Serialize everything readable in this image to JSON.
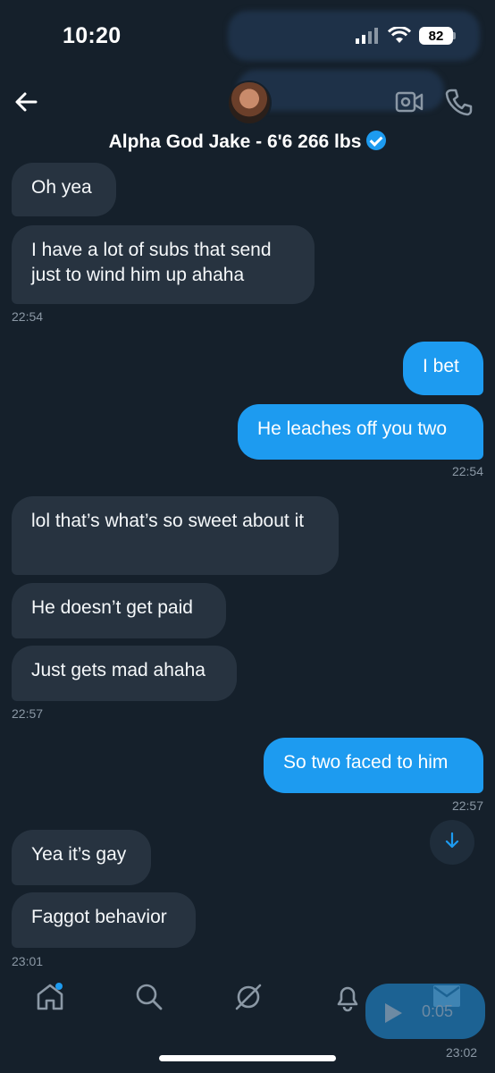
{
  "status_bar": {
    "time": "10:20",
    "battery": "82"
  },
  "header": {
    "contact_name": "Alpha God Jake - 6'6 266 lbs"
  },
  "messages": [
    {
      "side": "in",
      "text": "Oh yea"
    },
    {
      "side": "in",
      "text": "I have a lot of subs that send just to wind him up ahaha",
      "time": "22:54"
    },
    {
      "side": "out",
      "text": "I bet"
    },
    {
      "side": "out",
      "text": "He leaches off you two",
      "time": "22:54"
    },
    {
      "side": "in",
      "text": "lol that’s what’s so sweet about it"
    },
    {
      "side": "in",
      "text": "He doesn’t get paid"
    },
    {
      "side": "in",
      "text": "Just gets mad ahaha",
      "time": "22:57"
    },
    {
      "side": "out",
      "text": "So two faced to him",
      "time": "22:57"
    },
    {
      "side": "in",
      "text": "Yea it’s gay"
    },
    {
      "side": "in",
      "text": "Faggot behavior",
      "time": "23:01"
    }
  ],
  "voice_message": {
    "duration": "0:05",
    "time": "23:02"
  },
  "icons": {
    "back": "back-arrow-icon",
    "video": "video-call-icon",
    "phone": "phone-icon",
    "scroll": "arrow-down-icon",
    "home": "home-icon",
    "search": "search-icon",
    "grok": "grok-icon",
    "notifications": "bell-icon",
    "messages": "mail-icon"
  },
  "colors": {
    "background": "#15202b",
    "incoming": "#273340",
    "outgoing": "#1d9bf0",
    "timestamp": "#8b98a5"
  }
}
